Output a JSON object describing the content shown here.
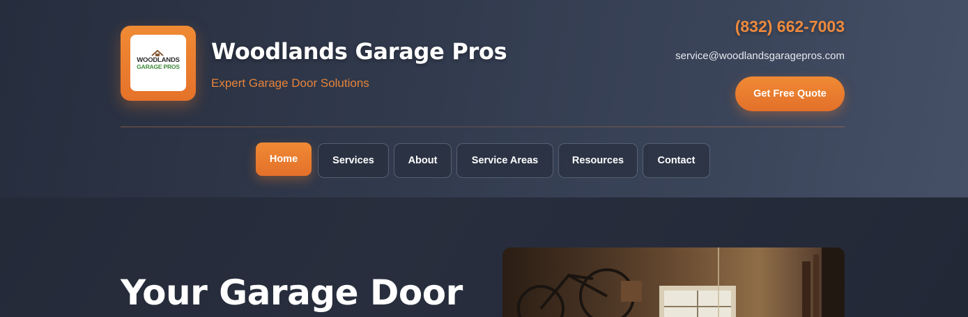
{
  "brand": {
    "logo_line1": "WOODLANDS",
    "logo_line2": "GARAGE PROS",
    "name": "Woodlands Garage Pros",
    "tagline": "Expert Garage Door Solutions"
  },
  "contact": {
    "phone": "(832) 662-7003",
    "email": "service@woodlandsgaragepros.com",
    "cta_label": "Get Free Quote"
  },
  "nav": {
    "items": [
      {
        "label": "Home",
        "active": true
      },
      {
        "label": "Services",
        "active": false
      },
      {
        "label": "About",
        "active": false
      },
      {
        "label": "Service Areas",
        "active": false
      },
      {
        "label": "Resources",
        "active": false
      },
      {
        "label": "Contact",
        "active": false
      }
    ]
  },
  "hero": {
    "title": "Your Garage Door"
  },
  "colors": {
    "accent": "#ee8a3c",
    "header_bg": "#323b4e",
    "hero_bg": "#252b3a",
    "logo_green": "#3e8a3b"
  }
}
